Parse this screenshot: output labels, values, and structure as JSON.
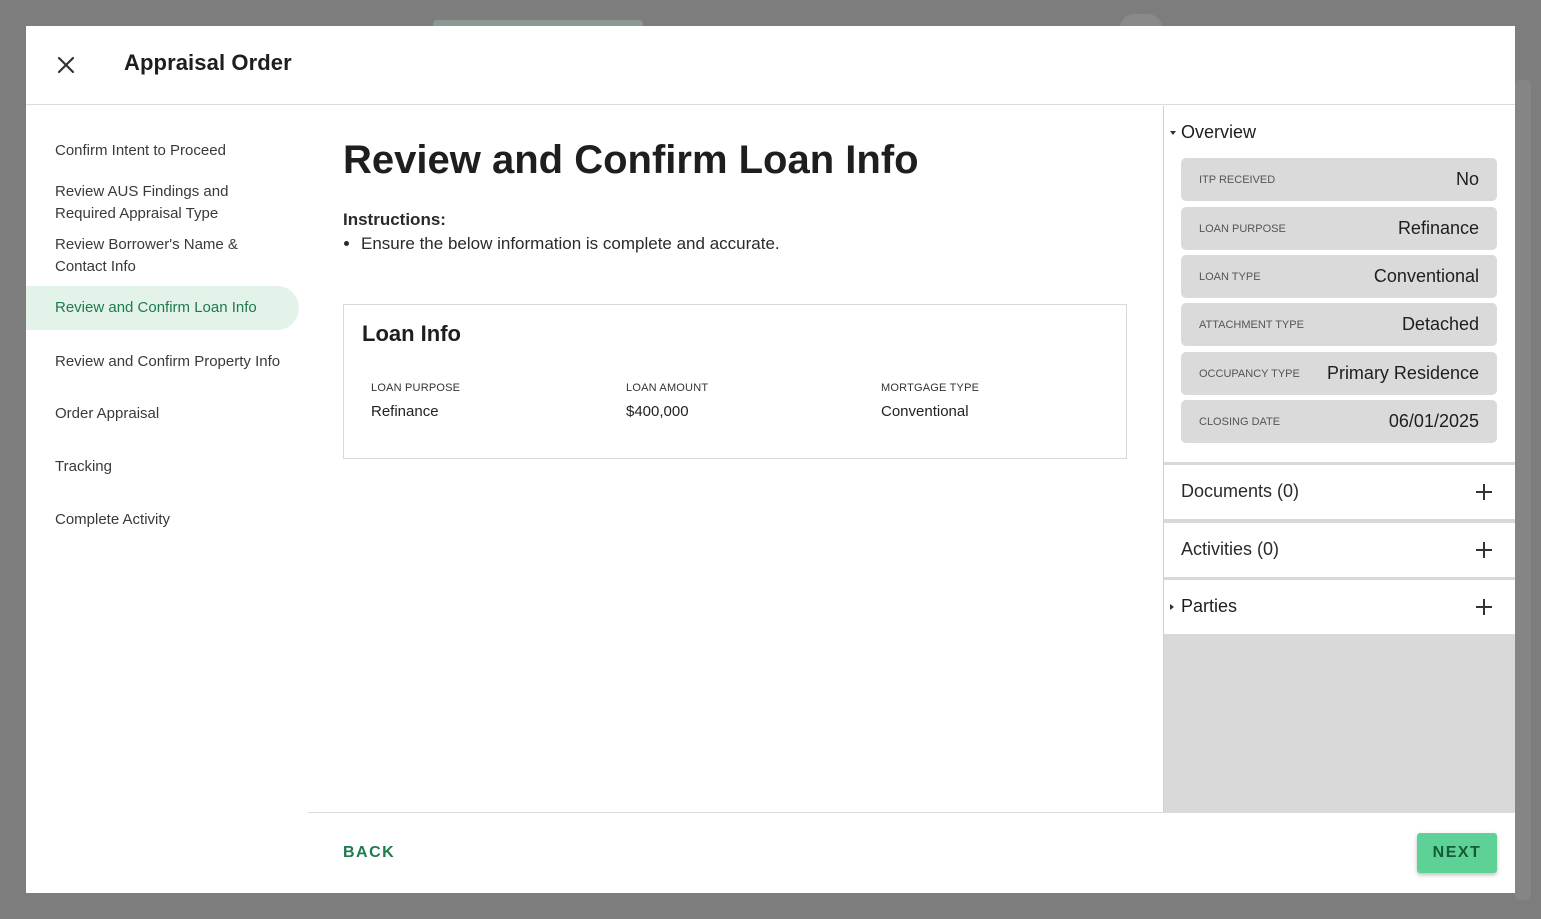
{
  "modal": {
    "title": "Appraisal Order"
  },
  "nav": {
    "items": [
      {
        "label": "Confirm Intent to Proceed"
      },
      {
        "label": "Review AUS Findings and Required Appraisal Type"
      },
      {
        "label": "Review Borrower's Name & Contact Info"
      },
      {
        "label": "Review and Confirm Loan Info",
        "active": true
      },
      {
        "label": "Review and Confirm Property Info"
      },
      {
        "label": "Order Appraisal"
      },
      {
        "label": "Tracking"
      },
      {
        "label": "Complete Activity"
      }
    ]
  },
  "main": {
    "heading": "Review and Confirm Loan Info",
    "instructions_label": "Instructions:",
    "instructions": [
      "Ensure the below information is complete and accurate."
    ],
    "card": {
      "title": "Loan Info",
      "fields": [
        {
          "label": "LOAN PURPOSE",
          "value": "Refinance"
        },
        {
          "label": "LOAN AMOUNT",
          "value": "$400,000"
        },
        {
          "label": "MORTGAGE TYPE",
          "value": "Conventional"
        }
      ]
    }
  },
  "footer": {
    "back_label": "BACK",
    "next_label": "NEXT"
  },
  "sidebar": {
    "overview": {
      "title": "Overview",
      "rows": [
        {
          "label": "ITP RECEIVED",
          "value": "No"
        },
        {
          "label": "LOAN PURPOSE",
          "value": "Refinance"
        },
        {
          "label": "LOAN TYPE",
          "value": "Conventional"
        },
        {
          "label": "ATTACHMENT TYPE",
          "value": "Detached"
        },
        {
          "label": "OCCUPANCY TYPE",
          "value": "Primary Residence"
        },
        {
          "label": "CLOSING DATE",
          "value": "06/01/2025"
        }
      ]
    },
    "documents": {
      "title": "Documents (0)"
    },
    "activities": {
      "title": "Activities (0)"
    },
    "parties": {
      "title": "Parties"
    }
  },
  "colors": {
    "accent": "#1f7a4e",
    "active_bg": "#e3f3ea",
    "next_button": "#5ed197",
    "panel_gray": "#d9d9d9",
    "overlay": "#7d7d7d"
  }
}
